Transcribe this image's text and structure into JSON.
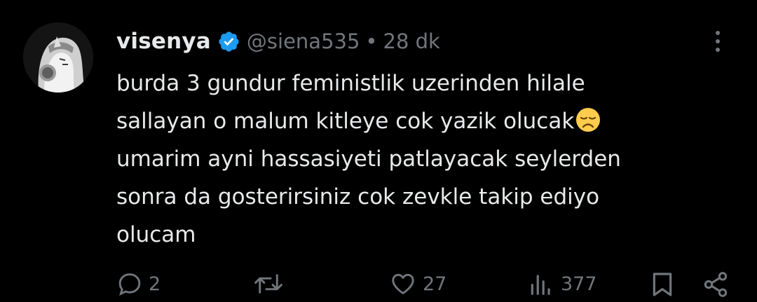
{
  "tweet": {
    "display_name": "visenya",
    "handle": "@siena535",
    "separator": "•",
    "time": "28 dk",
    "lines": [
      "burda 3 gundur feministlik uzerinden hilale",
      "sallayan o malum kitleye cok yazik olucak",
      "umarim ayni hassasiyeti patlayacak seylerden",
      "sonra da gosterirsiniz cok zevkle takip ediyo",
      "olucam"
    ],
    "emoji": "disappointed-face",
    "verified_color": "#1d9bf0"
  },
  "actions": {
    "reply_count": "2",
    "retweet_count": "",
    "like_count": "27",
    "view_count": "377"
  },
  "colors": {
    "background": "#000000",
    "text": "#e7e9ea",
    "secondary": "#71767b",
    "emoji_yellow": "#ffcc4d"
  }
}
